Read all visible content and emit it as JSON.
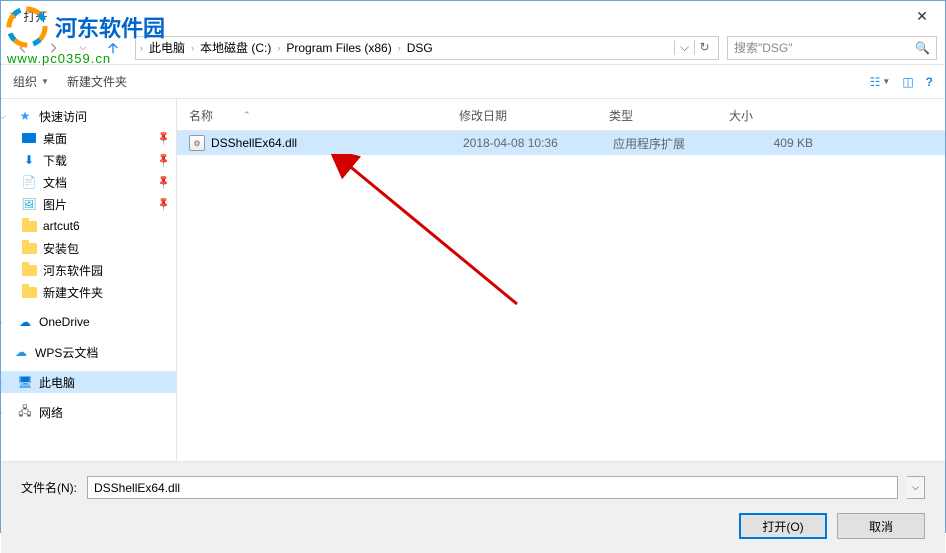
{
  "window": {
    "title": "打开"
  },
  "watermark": {
    "brand": "河东软件园",
    "url": "www.pc0359.cn"
  },
  "breadcrumb": {
    "items": [
      "此电脑",
      "本地磁盘 (C:)",
      "Program Files (x86)",
      "DSG"
    ]
  },
  "search": {
    "placeholder": "搜索\"DSG\""
  },
  "toolbar": {
    "organize": "组织",
    "newfolder": "新建文件夹"
  },
  "sidebar": {
    "quick_access": "快速访问",
    "desktop": "桌面",
    "downloads": "下载",
    "documents": "文档",
    "pictures": "图片",
    "artcut6": "artcut6",
    "install_pkg": "安装包",
    "hedong": "河东软件园",
    "new_folder": "新建文件夹",
    "onedrive": "OneDrive",
    "wps": "WPS云文档",
    "this_pc": "此电脑",
    "network": "网络"
  },
  "columns": {
    "name": "名称",
    "date": "修改日期",
    "type": "类型",
    "size": "大小"
  },
  "files": [
    {
      "name": "DSShellEx64.dll",
      "date": "2018-04-08 10:36",
      "type": "应用程序扩展",
      "size": "409 KB"
    }
  ],
  "bottom": {
    "filename_label": "文件名(N):",
    "filename_value": "DSShellEx64.dll",
    "open": "打开(O)",
    "cancel": "取消"
  }
}
